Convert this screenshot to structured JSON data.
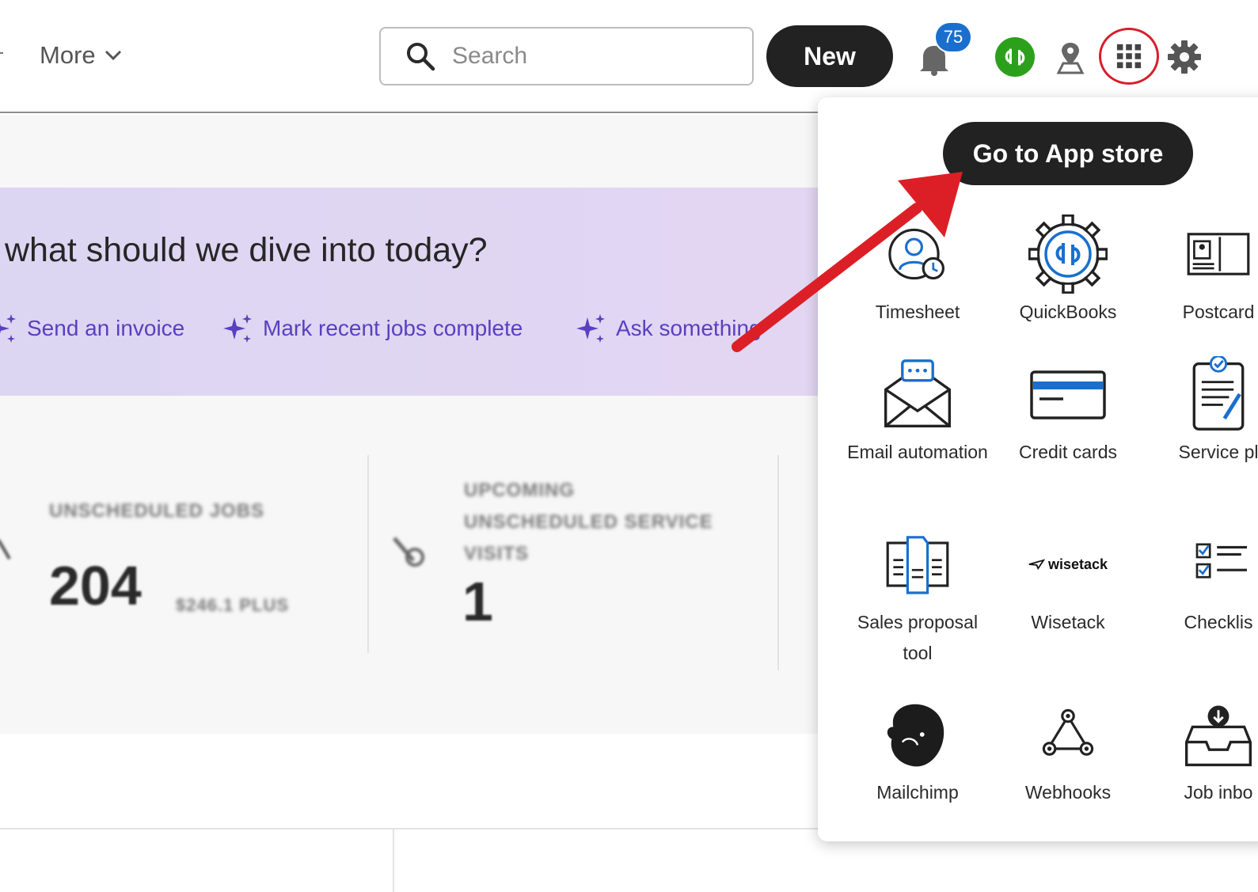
{
  "header": {
    "more_label": "More",
    "search_placeholder": "Search",
    "new_label": "New",
    "notification_count": "75",
    "brand_color": "#2ca01c",
    "highlight_color": "#d81e2a"
  },
  "banner": {
    "title": "what should we dive into today?",
    "actions": [
      {
        "label": "Send an invoice"
      },
      {
        "label": "Mark recent jobs complete"
      },
      {
        "label": "Ask something"
      }
    ],
    "accent": "#5a3fc0"
  },
  "stats": [
    {
      "label": "UNSCHEDULED JOBS",
      "value": "204",
      "sub": "$246.1 PLUS"
    },
    {
      "label": "UPCOMING UNSCHEDULED SERVICE VISITS",
      "value": "1"
    }
  ],
  "apps_menu": {
    "store_button": "Go to App store",
    "apps": [
      {
        "label": "Timesheet",
        "icon": "timesheet-icon"
      },
      {
        "label": "QuickBooks",
        "icon": "quickbooks-gear-icon"
      },
      {
        "label": "Postcard",
        "icon": "postcard-icon"
      },
      {
        "label": "Email automation",
        "icon": "email-automation-icon"
      },
      {
        "label": "Credit cards",
        "icon": "credit-card-icon"
      },
      {
        "label": "Service pl",
        "icon": "service-plan-icon"
      },
      {
        "label": "Sales proposal tool",
        "icon": "sales-proposal-icon"
      },
      {
        "label": "Wisetack",
        "icon": "wisetack-logo",
        "logo_text": "wisetack"
      },
      {
        "label": "Checklis",
        "icon": "checklist-icon"
      },
      {
        "label": "Mailchimp",
        "icon": "mailchimp-icon"
      },
      {
        "label": "Webhooks",
        "icon": "webhooks-icon"
      },
      {
        "label": "Job inbo",
        "icon": "job-inbox-icon"
      }
    ]
  }
}
